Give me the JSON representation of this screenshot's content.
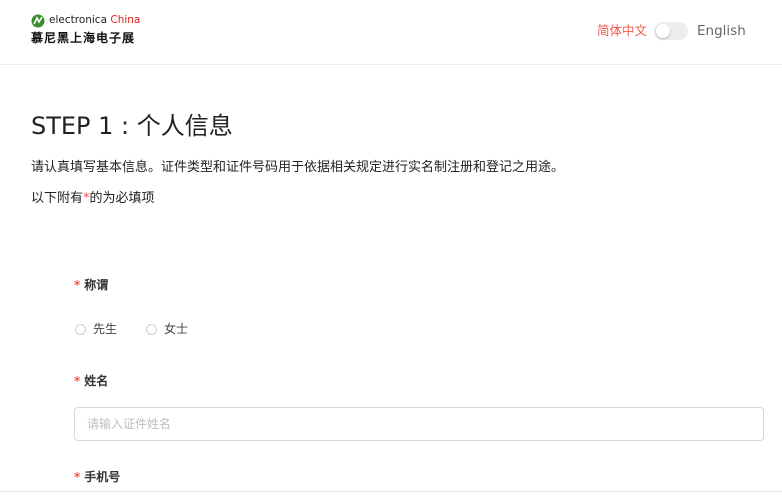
{
  "header": {
    "logo": {
      "brand_a": "electronica",
      "brand_b": "China",
      "subtitle": "慕尼黑上海电子展"
    },
    "lang_cn": "简体中文",
    "lang_en": "English"
  },
  "step": {
    "title": "STEP 1 : 个人信息",
    "description": "请认真填写基本信息。证件类型和证件号码用于依据相关规定进行实名制注册和登记之用途。",
    "required_note_prefix": "以下附有",
    "required_star": "*",
    "required_note_suffix": "的为必填项"
  },
  "form": {
    "salutation": {
      "star": "*",
      "label": "称谓",
      "options": [
        "先生",
        "女士"
      ]
    },
    "name": {
      "star": "*",
      "label": "姓名",
      "placeholder": "请输入证件姓名"
    },
    "phone": {
      "star": "*",
      "label": "手机号"
    }
  },
  "colors": {
    "accent": "#f5574c",
    "brand_green": "#3d8b2f",
    "border": "#d9d9d9"
  }
}
